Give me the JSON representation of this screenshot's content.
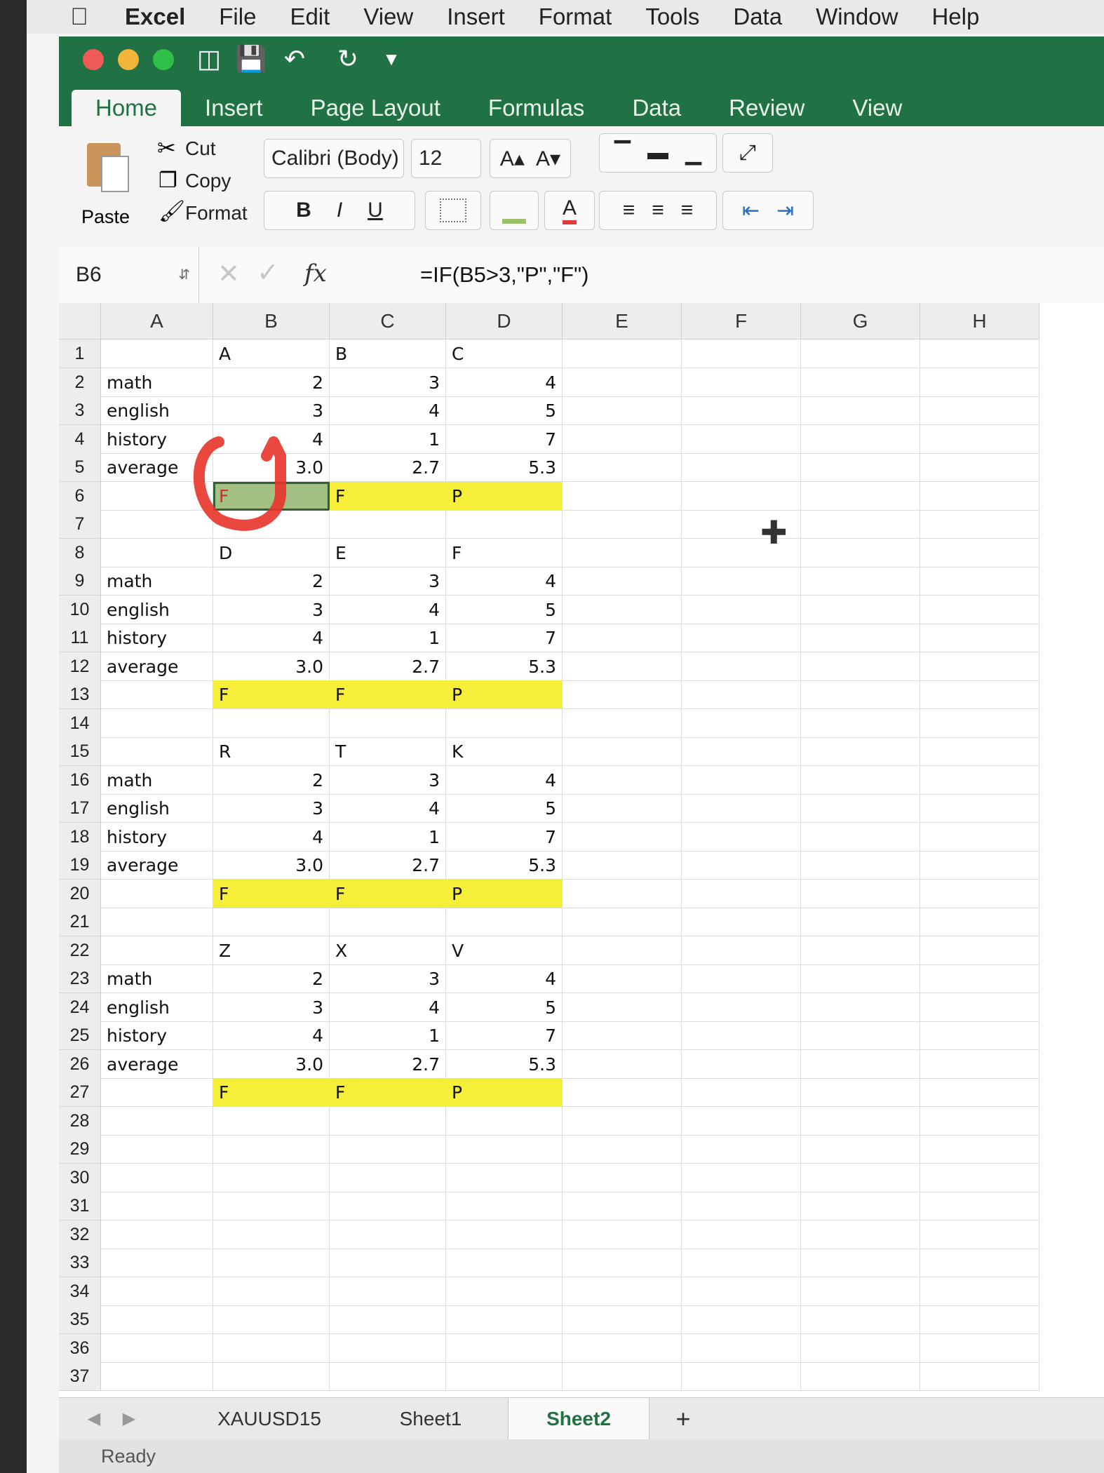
{
  "menubar": {
    "app": "Excel",
    "items": [
      "File",
      "Edit",
      "View",
      "Insert",
      "Format",
      "Tools",
      "Data",
      "Window",
      "Help"
    ]
  },
  "ribbon_tabs": [
    "Home",
    "Insert",
    "Page Layout",
    "Formulas",
    "Data",
    "Review",
    "View"
  ],
  "ribbon": {
    "paste": "Paste",
    "cut": "Cut",
    "copy": "Copy",
    "format": "Format",
    "font_name": "Calibri (Body)",
    "font_size": "12",
    "bold": "B",
    "italic": "I",
    "underline": "U",
    "font_color_glyph": "A",
    "grow_font": "A▴",
    "shrink_font": "A▾"
  },
  "formula_bar": {
    "name_box": "B6",
    "fx": "fx",
    "formula": "=IF(B5>3,\"P\",\"F\")"
  },
  "columns": [
    "A",
    "B",
    "C",
    "D",
    "E",
    "F",
    "G",
    "H"
  ],
  "rows": [
    {
      "n": "1",
      "a": "",
      "b": "A",
      "c": "B",
      "d": "C"
    },
    {
      "n": "2",
      "a": "math",
      "b": "2",
      "c": "3",
      "d": "4"
    },
    {
      "n": "3",
      "a": "english",
      "b": "3",
      "c": "4",
      "d": "5"
    },
    {
      "n": "4",
      "a": "history",
      "b": "4",
      "c": "1",
      "d": "7"
    },
    {
      "n": "5",
      "a": "average",
      "b": "3.0",
      "c": "2.7",
      "d": "5.3"
    },
    {
      "n": "6",
      "a": "",
      "b": "F",
      "c": "F",
      "d": "P",
      "hl": true,
      "sel": true
    },
    {
      "n": "7",
      "a": "",
      "b": "",
      "c": "",
      "d": ""
    },
    {
      "n": "8",
      "a": "",
      "b": "D",
      "c": "E",
      "d": "F"
    },
    {
      "n": "9",
      "a": "math",
      "b": "2",
      "c": "3",
      "d": "4"
    },
    {
      "n": "10",
      "a": "english",
      "b": "3",
      "c": "4",
      "d": "5"
    },
    {
      "n": "11",
      "a": "history",
      "b": "4",
      "c": "1",
      "d": "7"
    },
    {
      "n": "12",
      "a": "average",
      "b": "3.0",
      "c": "2.7",
      "d": "5.3"
    },
    {
      "n": "13",
      "a": "",
      "b": "F",
      "c": "F",
      "d": "P",
      "hl": true
    },
    {
      "n": "14",
      "a": "",
      "b": "",
      "c": "",
      "d": ""
    },
    {
      "n": "15",
      "a": "",
      "b": "R",
      "c": "T",
      "d": "K"
    },
    {
      "n": "16",
      "a": "math",
      "b": "2",
      "c": "3",
      "d": "4"
    },
    {
      "n": "17",
      "a": "english",
      "b": "3",
      "c": "4",
      "d": "5"
    },
    {
      "n": "18",
      "a": "history",
      "b": "4",
      "c": "1",
      "d": "7"
    },
    {
      "n": "19",
      "a": "average",
      "b": "3.0",
      "c": "2.7",
      "d": "5.3"
    },
    {
      "n": "20",
      "a": "",
      "b": "F",
      "c": "F",
      "d": "P",
      "hl": true
    },
    {
      "n": "21",
      "a": "",
      "b": "",
      "c": "",
      "d": ""
    },
    {
      "n": "22",
      "a": "",
      "b": "Z",
      "c": "X",
      "d": "V"
    },
    {
      "n": "23",
      "a": "math",
      "b": "2",
      "c": "3",
      "d": "4"
    },
    {
      "n": "24",
      "a": "english",
      "b": "3",
      "c": "4",
      "d": "5"
    },
    {
      "n": "25",
      "a": "history",
      "b": "4",
      "c": "1",
      "d": "7"
    },
    {
      "n": "26",
      "a": "average",
      "b": "3.0",
      "c": "2.7",
      "d": "5.3"
    },
    {
      "n": "27",
      "a": "",
      "b": "F",
      "c": "F",
      "d": "P",
      "hl": true
    },
    {
      "n": "28",
      "a": "",
      "b": "",
      "c": "",
      "d": ""
    },
    {
      "n": "29",
      "a": "",
      "b": "",
      "c": "",
      "d": ""
    },
    {
      "n": "30",
      "a": "",
      "b": "",
      "c": "",
      "d": ""
    },
    {
      "n": "31",
      "a": "",
      "b": "",
      "c": "",
      "d": ""
    },
    {
      "n": "32",
      "a": "",
      "b": "",
      "c": "",
      "d": ""
    },
    {
      "n": "33",
      "a": "",
      "b": "",
      "c": "",
      "d": ""
    },
    {
      "n": "34",
      "a": "",
      "b": "",
      "c": "",
      "d": ""
    },
    {
      "n": "35",
      "a": "",
      "b": "",
      "c": "",
      "d": ""
    },
    {
      "n": "36",
      "a": "",
      "b": "",
      "c": "",
      "d": ""
    },
    {
      "n": "37",
      "a": "",
      "b": "",
      "c": "",
      "d": ""
    }
  ],
  "sheet_tabs": [
    "XAUUSD15",
    "Sheet1",
    "Sheet2"
  ],
  "active_sheet": "Sheet2",
  "add_sheet": "+",
  "status": "Ready",
  "colors": {
    "excel_green": "#207245",
    "highlight_yellow": "#f6ef3a",
    "selection_green": "#a3c084",
    "annotation_red": "#e8342a"
  }
}
